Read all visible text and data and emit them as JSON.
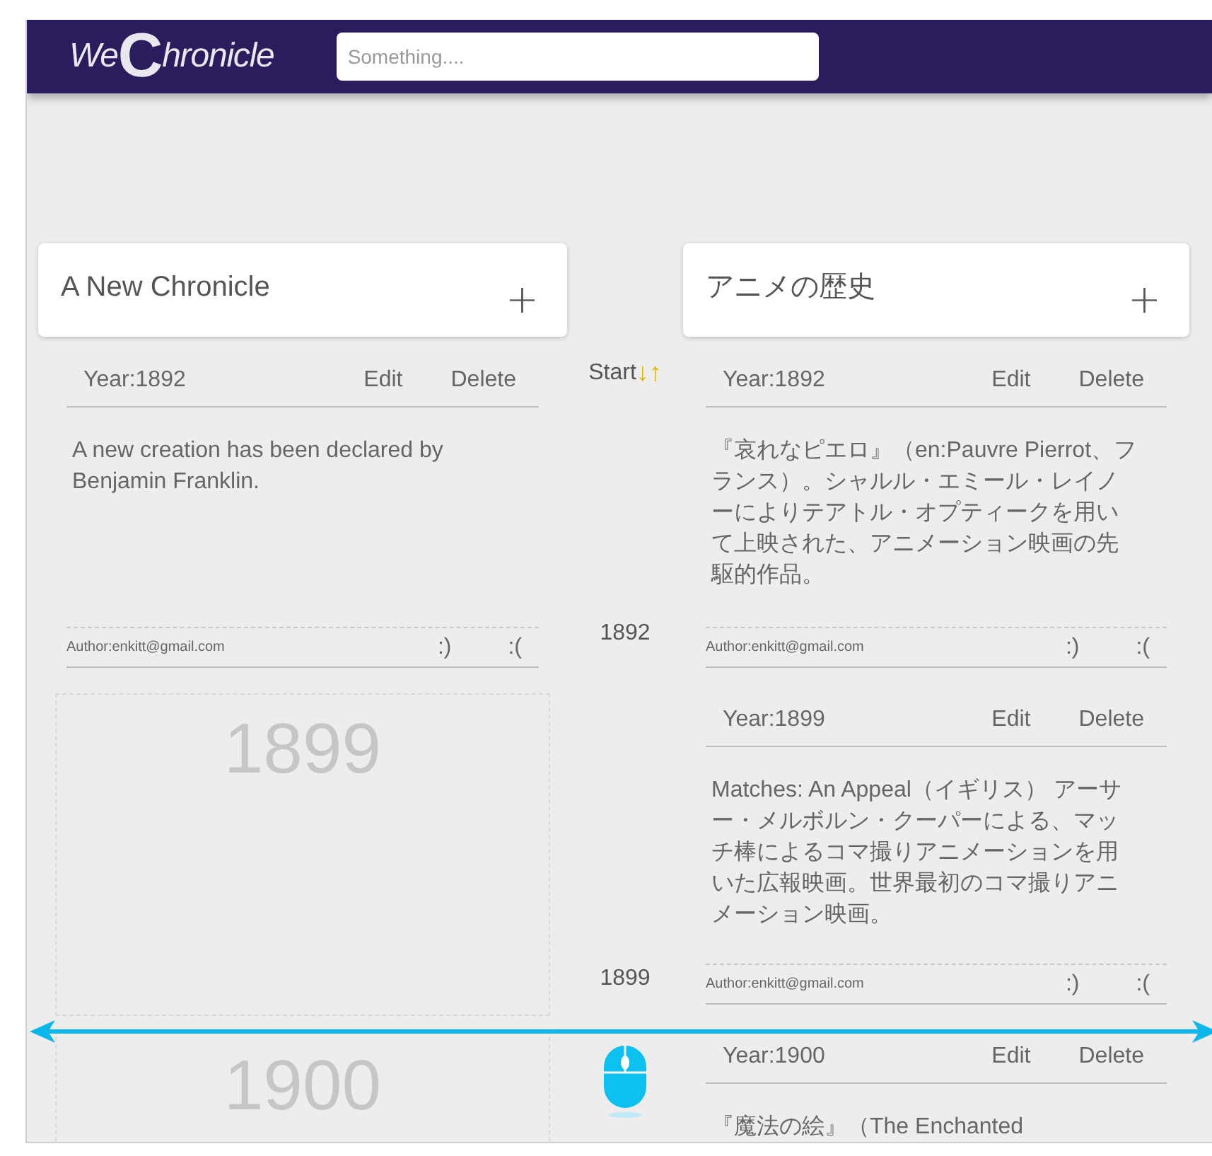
{
  "header": {
    "logo": {
      "before": "We",
      "initial": "C",
      "after": "hronicle"
    },
    "search": {
      "placeholder": "Something...."
    }
  },
  "timeline": {
    "start_label": "Start",
    "sort_icon": "↓↑",
    "years": [
      "1892",
      "1899"
    ]
  },
  "chronicles": [
    {
      "title": "A New Chronicle",
      "add": "+",
      "entries": [
        {
          "kind": "entry",
          "year_label": "Year:1892",
          "edit": "Edit",
          "delete": "Delete",
          "body": "A new creation has been declared by Benjamin Franklin.",
          "author": "Author:enkitt@gmail.com",
          "like": ":)",
          "dislike": ":("
        },
        {
          "kind": "empty",
          "year": "1899"
        },
        {
          "kind": "empty",
          "year": "1900"
        }
      ]
    },
    {
      "title": "アニメの歴史",
      "add": "+",
      "entries": [
        {
          "kind": "entry",
          "year_label": "Year:1892",
          "edit": "Edit",
          "delete": "Delete",
          "body": "『哀れなピエロ』（en:Pauvre Pierrot、フランス）。シャルル・エミール・レイノーによりテアトル・オプティークを用いて上映された、アニメーション映画の先駆的作品。",
          "author": "Author:enkitt@gmail.com",
          "like": ":)",
          "dislike": ":("
        },
        {
          "kind": "entry",
          "year_label": "Year:1899",
          "edit": "Edit",
          "delete": "Delete",
          "body": "Matches: An Appeal（イギリス） アーサー・メルボルン・クーパーによる、マッチ棒によるコマ撮りアニメーションを用いた広報映画。世界最初のコマ撮りアニメーション映画。",
          "author": "Author:enkitt@gmail.com",
          "like": ":)",
          "dislike": ":("
        },
        {
          "kind": "entry",
          "year_label": "Year:1900",
          "edit": "Edit",
          "delete": "Delete",
          "body": "『魔法の絵』（The Enchanted"
        }
      ]
    }
  ]
}
